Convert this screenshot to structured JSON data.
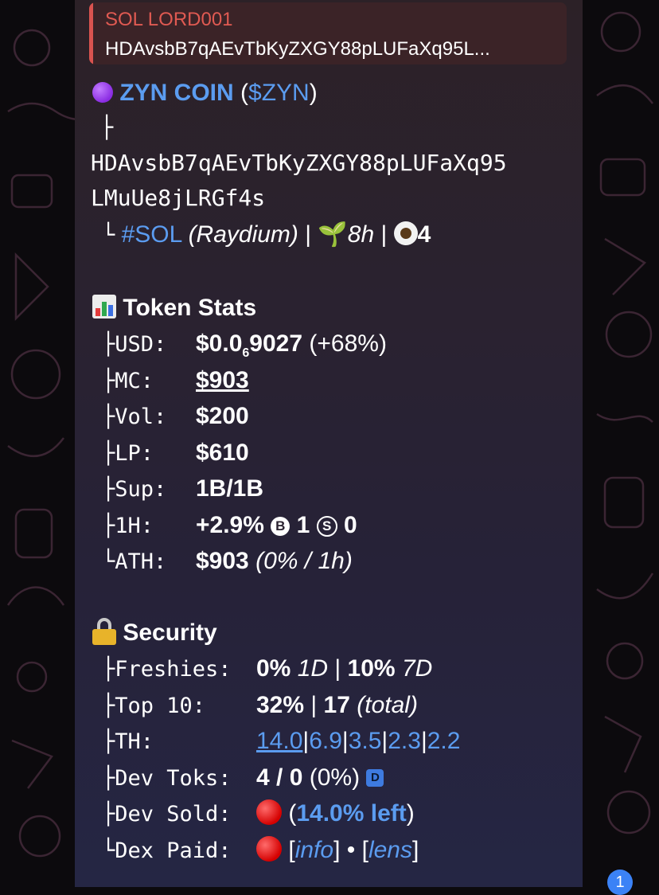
{
  "reply": {
    "sender": "SOL LORD001",
    "preview": "HDAvsbB7qAEvTbKyZXGY88pLUFaXq95L..."
  },
  "token": {
    "name": "ZYN COIN",
    "paren_open": "(",
    "ticker": "$ZYN",
    "paren_close": ")",
    "tree_top": "├",
    "address_line1": "HDAvsbB7qAEvTbKyZXGY88pLUFaXq95",
    "address_line2": "LMuUe8jLRGf4s",
    "tree_end": "└",
    "chain_tag": "#SOL",
    "dex": "(Raydium)",
    "sep": "|",
    "age": "8h",
    "watchers": "4"
  },
  "stats": {
    "heading": "Token Stats",
    "usd_label": "├USD:",
    "usd_prefix": "$0.0",
    "usd_sub": "6",
    "usd_digits": "9027",
    "usd_change": "(+68%)",
    "mc_label": "├MC:",
    "mc_value": "$903",
    "vol_label": "├Vol:",
    "vol_value": "$200",
    "lp_label": "├LP:",
    "lp_value": "$610",
    "sup_label": "├Sup:",
    "sup_value": "1B/1B",
    "h1_label": "├1H:",
    "h1_change": "+2.9%",
    "h1_b_icon": "B",
    "h1_buys": "1",
    "h1_s_icon": "S",
    "h1_sells": "0",
    "ath_label": "└ATH:",
    "ath_value": "$903",
    "ath_detail": "(0% / 1h)"
  },
  "security": {
    "heading": "Security",
    "fresh_label": "├Freshies:",
    "fresh_1d_val": "0%",
    "fresh_1d": "1D",
    "fresh_7d_val": "10%",
    "fresh_7d": "7D",
    "top10_label": "├Top 10:",
    "top10_pct": "32%",
    "top10_count": "17",
    "top10_total": "(total)",
    "th_label": "├TH:",
    "th_values": [
      "14.0",
      "6.9",
      "3.5",
      "2.3",
      "2.2"
    ],
    "devtoks_label": "├Dev Toks:",
    "devtoks_value": "4 / 0",
    "devtoks_pct": "(0%)",
    "devtoks_badge": "D",
    "devsold_label": "├Dev Sold:",
    "devsold_open": "(",
    "devsold_left": "14.0% left",
    "devsold_close": ")",
    "dexpaid_label": "└Dex Paid:",
    "info_open": "[",
    "info_link": "info",
    "info_close": "]",
    "bullet": "•",
    "lens_open": "[",
    "lens_link": "lens",
    "lens_close": "]"
  },
  "unread_count": "1",
  "colors": {
    "accent_blue": "#5b9cf0",
    "reply_red": "#e05a52",
    "bubble_bg": "#2a2230"
  }
}
